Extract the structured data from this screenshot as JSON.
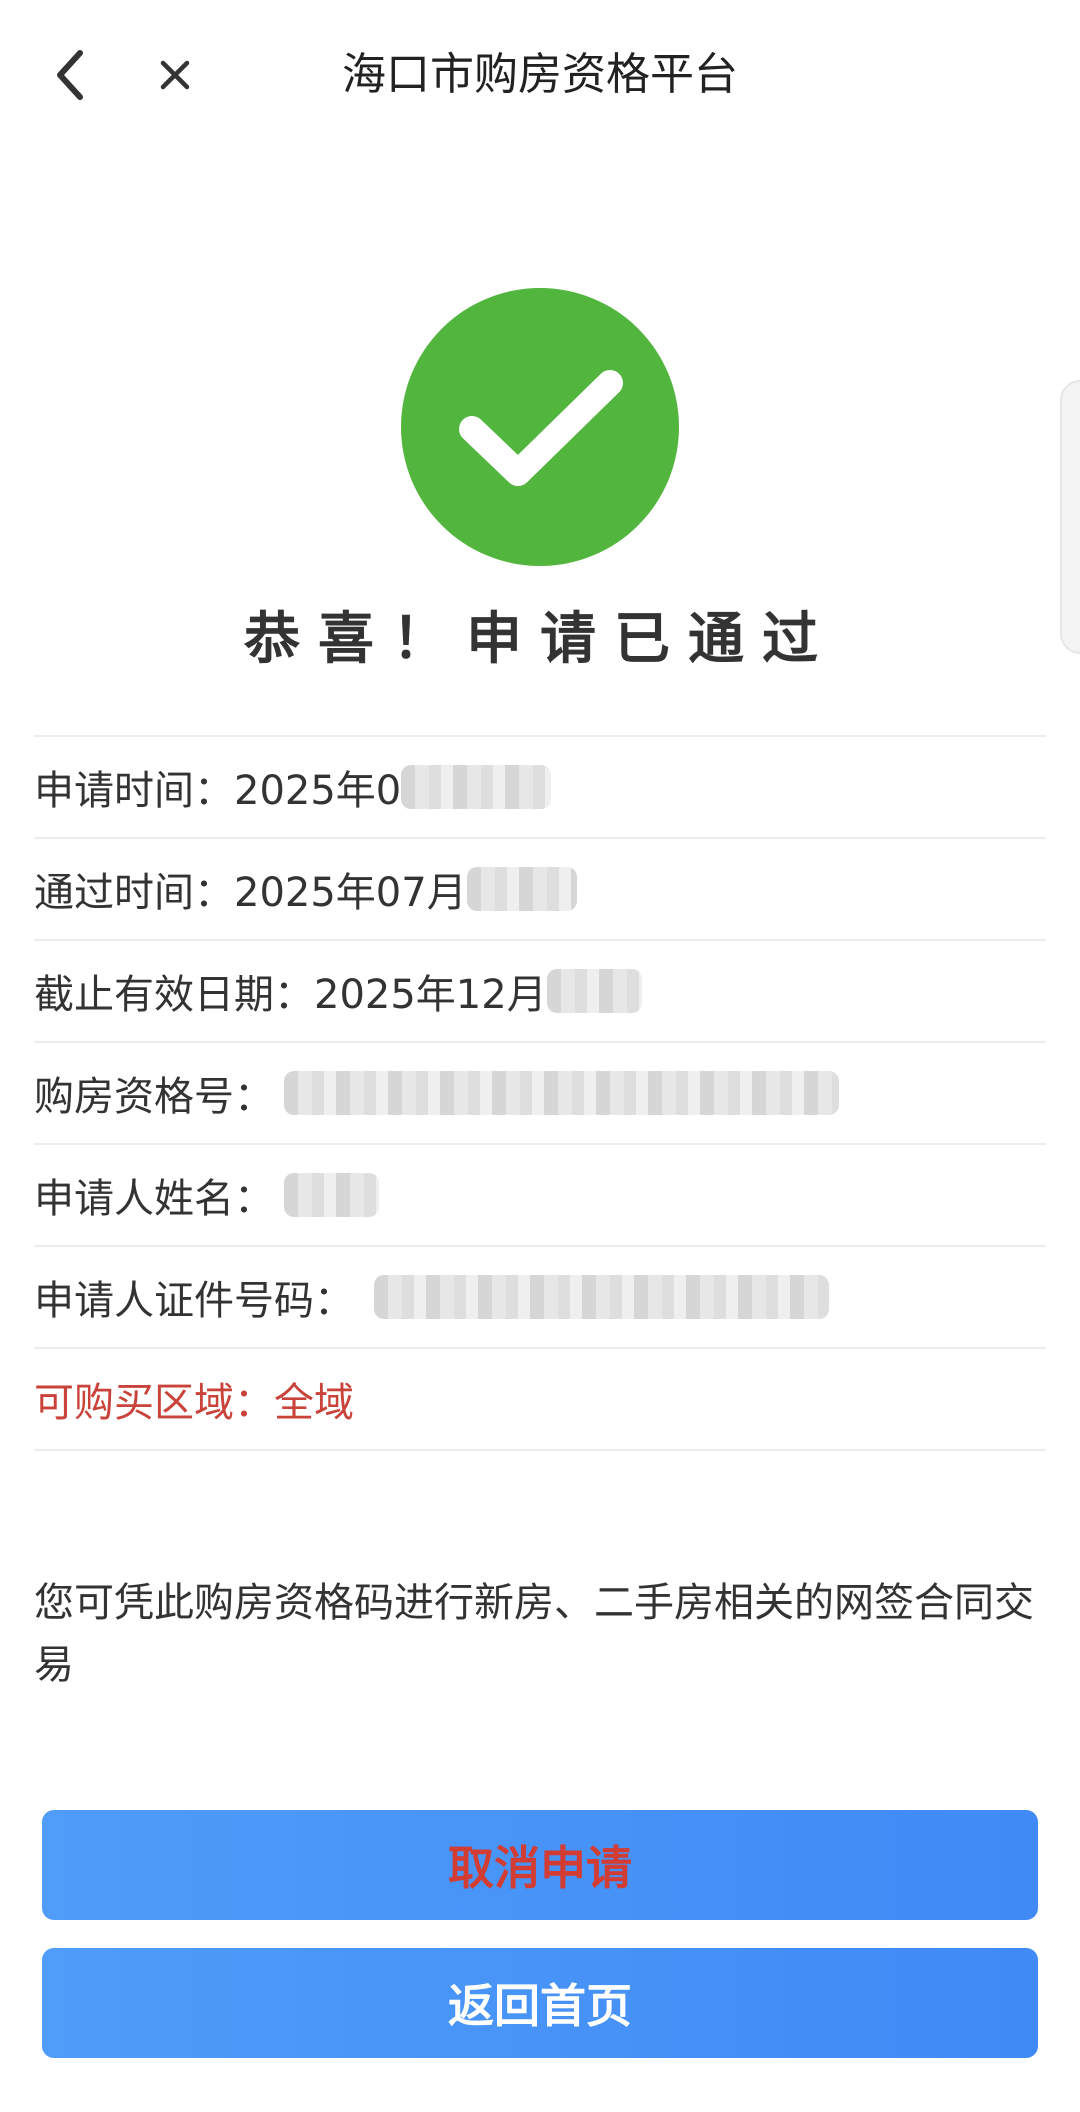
{
  "header": {
    "title": "海口市购房资格平台",
    "back_icon": "chevron-left-icon",
    "close_icon": "close-icon"
  },
  "result": {
    "icon": "check-circle-icon",
    "icon_color": "#52b63e",
    "title": "恭喜！申请已通过"
  },
  "info": {
    "apply_time_label": "申请时间：",
    "apply_time_value": "2025年0",
    "pass_time_label": "通过时间：",
    "pass_time_value": "2025年07月",
    "valid_until_label": "截止有效日期：",
    "valid_until_value": "2025年12月",
    "qualification_no_label": "购房资格号：",
    "applicant_name_label": "申请人姓名：",
    "applicant_id_label": "申请人证件号码：",
    "area_label": "可购买区域：",
    "area_value": "全域",
    "highlight_color": "#c9433a"
  },
  "note": "您可凭此购房资格码进行新房、二手房相关的网签合同交易",
  "buttons": {
    "cancel_label": "取消申请",
    "home_label": "返回首页",
    "background": "#4592f7",
    "cancel_text_color": "#d23c32"
  }
}
